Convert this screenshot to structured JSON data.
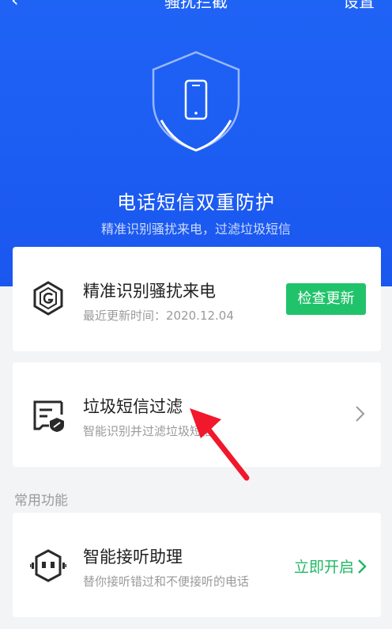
{
  "topbar": {
    "back_icon": "chevron-left-icon",
    "title": "骚扰拦截",
    "settings_label": "设置"
  },
  "hero": {
    "icon": "shield-phone-icon",
    "title": "电话短信双重防护",
    "subtitle": "精准识别骚扰来电，过滤垃圾短信"
  },
  "cards": {
    "call_id": {
      "icon": "hexagon-g-icon",
      "name": "精准识别骚扰来电",
      "desc": "最近更新时间：2020.12.04",
      "button": "检查更新"
    },
    "sms_filter": {
      "icon": "message-filter-icon",
      "name": "垃圾短信过滤",
      "desc": "智能识别并过滤垃圾短信"
    },
    "section_label": "常用功能",
    "assistant": {
      "icon": "robot-assistant-icon",
      "name": "智能接听助理",
      "desc": "替你接听错过和不便接听的电话",
      "action": "立即开启"
    }
  },
  "colors": {
    "hero_blue": "#1f63f5",
    "accent_green": "#21c36a",
    "arrow_red": "#f0182a"
  }
}
